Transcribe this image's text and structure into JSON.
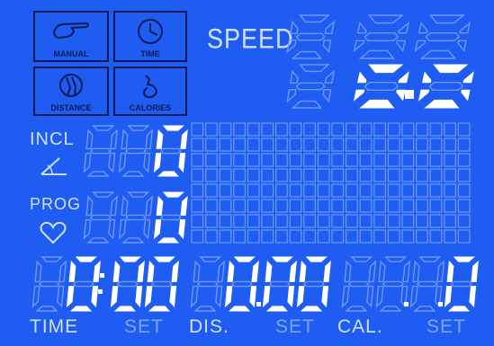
{
  "modes": [
    {
      "label": "MANUAL",
      "icon": "hand-pointer-icon"
    },
    {
      "label": "TIME",
      "icon": "clock-icon"
    },
    {
      "label": "DISTANCE",
      "icon": "running-shoe-icon"
    },
    {
      "label": "CALORIES",
      "icon": "flame-icon"
    }
  ],
  "speed": {
    "label": "SPEED",
    "value": "0.0"
  },
  "incline": {
    "label": "INCL",
    "value": "0",
    "icon": "incline-angle-icon"
  },
  "program": {
    "label": "PROG",
    "value": "0",
    "icon": "heart-icon"
  },
  "time": {
    "value": "0:00"
  },
  "distance": {
    "value": "0.00"
  },
  "calories": {
    "value": "0"
  },
  "bottom_labels": {
    "time": "TIME",
    "set1": "SET",
    "dis": "DIS.",
    "set2": "SET",
    "cal": "CAL.",
    "set3": "SET"
  },
  "colors": {
    "background": "#1f5cf2",
    "lit": "#ffffff",
    "unlit": "#6e97f7",
    "outline": "#0c1a5a"
  }
}
